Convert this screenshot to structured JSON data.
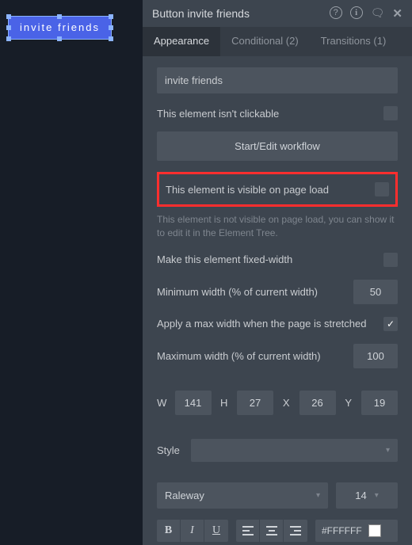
{
  "canvas": {
    "button_text": "invite friends"
  },
  "header": {
    "title": "Button invite friends",
    "icons": {
      "help": "?",
      "info": "i",
      "comment": "💬",
      "close": "✕"
    }
  },
  "tabs": {
    "appearance": "Appearance",
    "conditional": "Conditional (2)",
    "transitions": "Transitions (1)"
  },
  "fields": {
    "name_value": "invite friends",
    "not_clickable": "This element isn't clickable",
    "workflow_btn": "Start/Edit workflow",
    "visible_on_load": "This element is visible on page load",
    "visible_hint": "This element is not visible on page load, you can show it to edit it in the Element Tree.",
    "fixed_width": "Make this element fixed-width",
    "min_width_label": "Minimum width (% of current width)",
    "min_width_value": "50",
    "apply_max_label": "Apply a max width when the page is stretched",
    "max_width_label": "Maximum width (% of current width)",
    "max_width_value": "100"
  },
  "dims": {
    "w": "141",
    "h": "27",
    "x": "26",
    "y": "19",
    "W": "W",
    "H": "H",
    "X": "X",
    "Y": "Y"
  },
  "style": {
    "label": "Style",
    "value": ""
  },
  "font": {
    "family": "Raleway",
    "size": "14"
  },
  "text_format": {
    "bold": "B",
    "italic": "I",
    "underline": "U"
  },
  "color": {
    "hex": "#FFFFFF"
  }
}
